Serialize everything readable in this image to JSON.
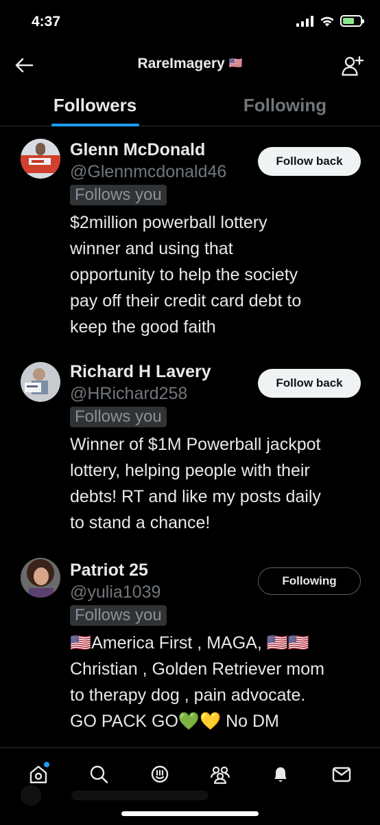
{
  "status_bar": {
    "time": "4:37"
  },
  "header": {
    "title": "RareImagery",
    "flag": "🇺🇸"
  },
  "tabs": [
    {
      "label": "Followers",
      "active": true
    },
    {
      "label": "Following",
      "active": false
    }
  ],
  "users": [
    {
      "name": "Glenn McDonald",
      "handle": "@Glennmcdonald46",
      "badge": "Follows you",
      "bio": "$2million powerball lottery\nwinner and using that\nopportunity to help the society\npay off their credit card debt to\nkeep the good faith",
      "button": "Follow back"
    },
    {
      "name": "Richard H Lavery",
      "handle": "@HRichard258",
      "badge": "Follows you",
      "bio": "Winner of $1M Powerball jackpot\nlottery, helping people with their\ndebts! RT and like my posts daily\nto stand a chance!",
      "button": "Follow back"
    },
    {
      "name": "Patriot 25",
      "handle": "@yulia1039",
      "badge": "Follows you",
      "bio": "🇺🇸America First , MAGA, 🇺🇸🇺🇸\nChristian , Golden Retriever mom\nto therapy dog , pain advocate.\nGO PACK GO💚💛  No DM",
      "button": "Following"
    }
  ],
  "icons": {
    "back": "arrow-left-icon",
    "add_user": "add-user-icon",
    "nav": [
      "home-icon",
      "search-icon",
      "grok-icon",
      "communities-icon",
      "bell-icon",
      "mail-icon"
    ]
  },
  "colors": {
    "accent": "#1d9bf0",
    "background": "#000000",
    "muted": "#71767b",
    "battery": "#8fe58b"
  }
}
